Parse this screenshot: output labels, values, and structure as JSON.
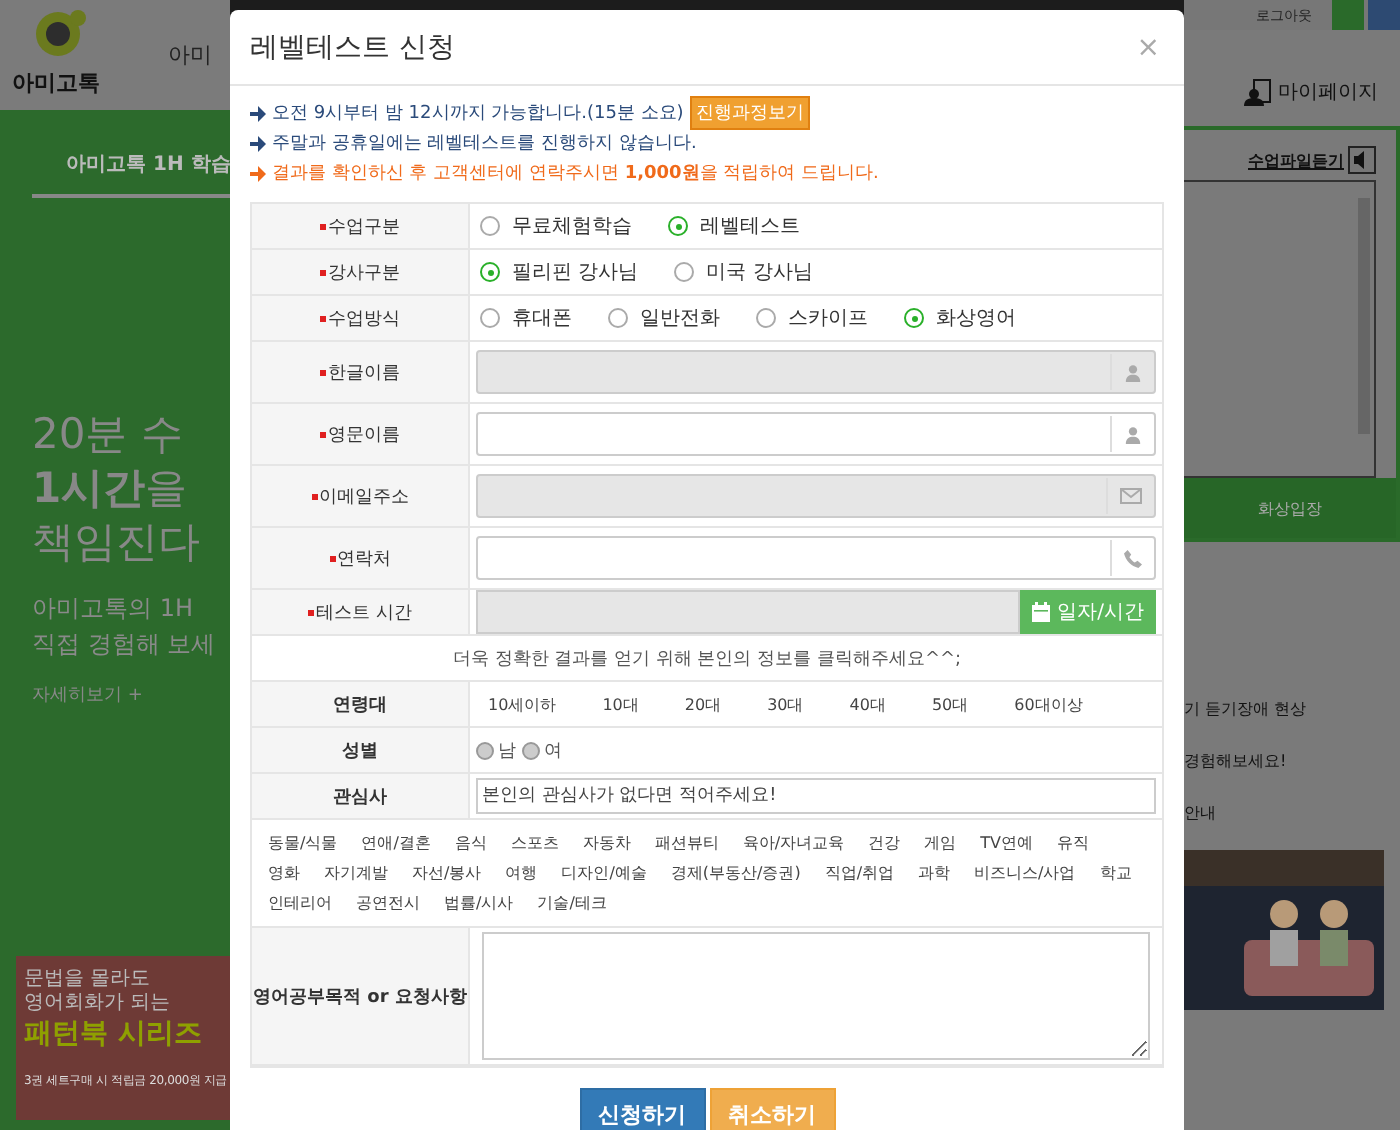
{
  "background": {
    "logo": "아미고톡",
    "nav_item": "아미",
    "hero_tab": "아미고톡 1H 학습",
    "headline": [
      "20분 수",
      "**1시간**을",
      "책임진다"
    ],
    "subtext": [
      "아미고톡의 1H",
      "직접 경험해 보세"
    ],
    "more_link": "자세히보기 +",
    "banner": {
      "lines": [
        "문법을 몰라도",
        "영어회화가 되는"
      ],
      "title": "패턴북 시리즈",
      "note": "3권 세트구매 시 적립금 20,000원 지급"
    },
    "logout": "로그아웃",
    "mypage": "마이페이지",
    "listen": "수업파일듣기",
    "enter_button": "화상입장",
    "notices": [
      "기 듣기장애 현상",
      "경험해보세요!",
      "안내"
    ]
  },
  "modal": {
    "title": "레벨테스트 신청",
    "close": "×",
    "notices": [
      {
        "text": "오전 9시부터 밤 12시까지 가능합니다.(15분 소요)",
        "kind": "info",
        "button": "진행과정보기"
      },
      {
        "text": "주말과 공휴일에는 레벨테스트를 진행하지 않습니다.",
        "kind": "info"
      },
      {
        "text": "결과를 확인하신 후 고객센터에 연락주시면 **1,000원**을 적립하여 드립니다.",
        "kind": "warning"
      }
    ],
    "rows": [
      {
        "kind": "radio",
        "label": "수업구분",
        "required": true,
        "options": [
          {
            "label": "무료체험학습",
            "selected": false
          },
          {
            "label": "레벨테스트",
            "selected": true
          }
        ]
      },
      {
        "kind": "radio",
        "label": "강사구분",
        "required": true,
        "options": [
          {
            "label": "필리핀 강사님",
            "selected": true
          },
          {
            "label": "미국 강사님",
            "selected": false
          }
        ]
      },
      {
        "kind": "radio",
        "label": "수업방식",
        "required": true,
        "options": [
          {
            "label": "휴대폰",
            "selected": false
          },
          {
            "label": "일반전화",
            "selected": false
          },
          {
            "label": "스카이프",
            "selected": false
          },
          {
            "label": "화상영어",
            "selected": true
          }
        ]
      },
      {
        "kind": "name",
        "label": "한글이름",
        "required": true,
        "disabled": true
      },
      {
        "kind": "name",
        "label": "영문이름",
        "required": true,
        "disabled": false
      },
      {
        "kind": "email",
        "label": "이메일주소",
        "required": true,
        "disabled": true
      },
      {
        "kind": "phone",
        "label": "연락처",
        "required": true,
        "disabled": false
      },
      {
        "kind": "datetime",
        "label": "테스트 시간",
        "required": true,
        "button": "일자/시간"
      },
      {
        "kind": "note",
        "text": "더욱 정확한 결과를 얻기 위해 본인의 정보를 클릭해주세요^^;"
      },
      {
        "kind": "choices",
        "label": "연령대",
        "options": [
          "10세이하",
          "10대",
          "20대",
          "30대",
          "40대",
          "50대",
          "60대이상"
        ]
      },
      {
        "kind": "small_radio",
        "label": "성별",
        "options": [
          {
            "label": "남",
            "selected": false
          },
          {
            "label": "여",
            "selected": false
          }
        ]
      },
      {
        "kind": "text",
        "label": "관심사",
        "placeholder": "본인의 관심사가 없다면 적어주세요!"
      },
      {
        "kind": "tags",
        "options": [
          "동물/식물",
          "연애/결혼",
          "음식",
          "스포츠",
          "자동차",
          "패션뷰티",
          "육아/자녀교육",
          "건강",
          "게임",
          "TV연예",
          "유직",
          "영화",
          "자기계발",
          "자선/봉사",
          "여행",
          "디자인/예술",
          "경제(부동산/증권)",
          "직업/취업",
          "과학",
          "비즈니스/사업",
          "학교",
          "인테리어",
          "공연전시",
          "법률/시사",
          "기술/테크"
        ]
      },
      {
        "kind": "textarea",
        "label": "영어공부목적 or 요청사항"
      }
    ],
    "buttons": [
      {
        "label": "신청하기",
        "kind": "primary"
      },
      {
        "label": "취소하기",
        "kind": "warning"
      }
    ]
  }
}
